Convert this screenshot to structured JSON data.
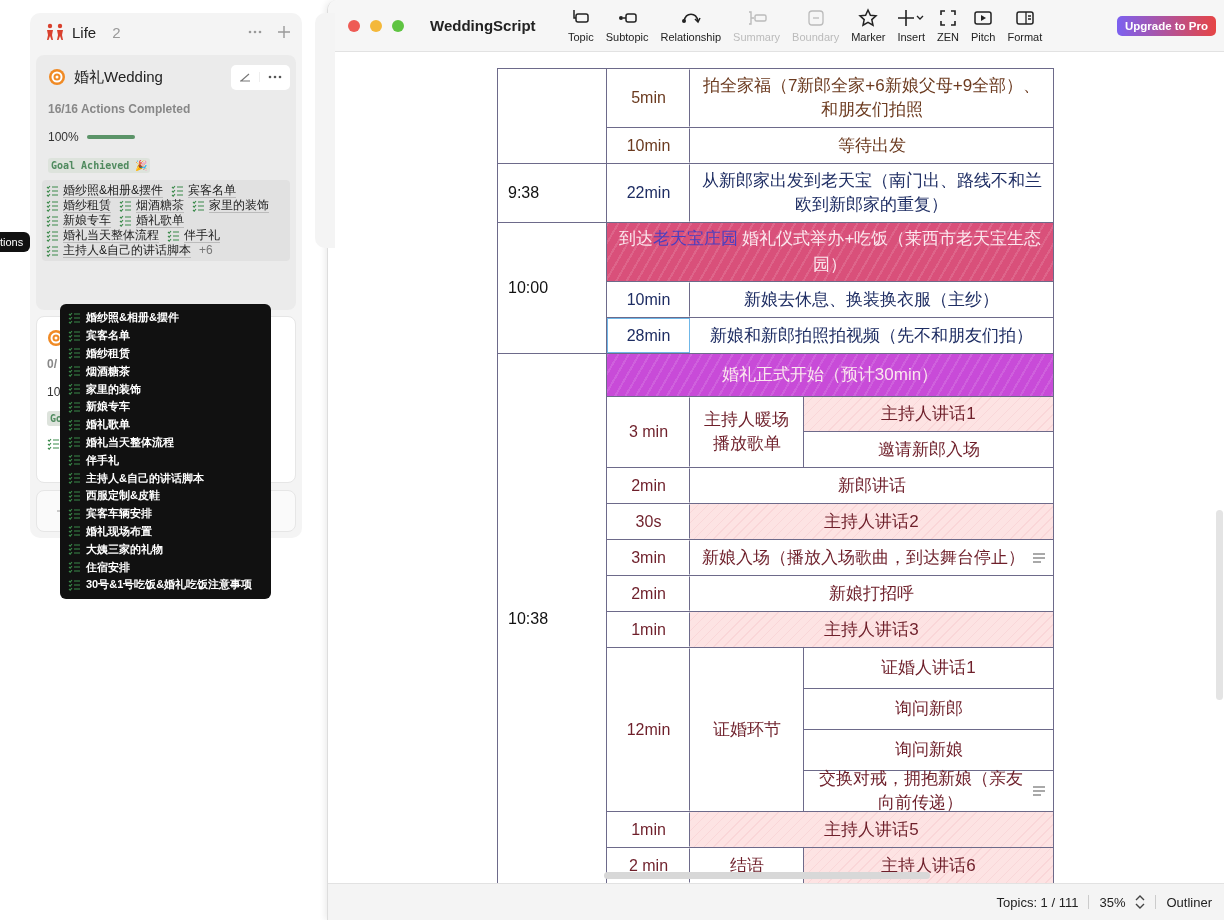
{
  "board": {
    "column": {
      "title": "Life",
      "count": "2"
    },
    "goal_card": {
      "title": "婚礼Wedding",
      "progress_text": "16/16 Actions Completed",
      "percent": "100%",
      "level": 1,
      "badge": "Goal Achieved 🎉",
      "actions": [
        "婚纱照&相册&摆件",
        "宾客名单",
        "婚纱租赁",
        "烟酒糖茶",
        "家里的装饰",
        "新娘专车",
        "婚礼歌单",
        "婚礼当天整体流程",
        "伴手礼",
        "主持人&自己的讲话脚本"
      ],
      "more": "+6"
    },
    "second_card": {
      "progress_text": "0/",
      "percent": "10",
      "badge": "Go"
    },
    "side_tooltip": "tions",
    "popup": [
      "婚纱照&相册&摆件",
      "宾客名单",
      "婚纱租赁",
      "烟酒糖茶",
      "家里的装饰",
      "新娘专车",
      "婚礼歌单",
      "婚礼当天整体流程",
      "伴手礼",
      "主持人&自己的讲话脚本",
      "西服定制&皮鞋",
      "宾客车辆安排",
      "婚礼现场布置",
      "大姨三家的礼物",
      "住宿安排",
      "30号&1号吃饭&婚礼吃饭注意事项"
    ]
  },
  "window": {
    "title": "WeddingScript",
    "toolbar": [
      {
        "label": "Topic",
        "kind": "topic",
        "disabled": false
      },
      {
        "label": "Subtopic",
        "kind": "subtopic",
        "disabled": false
      },
      {
        "label": "Relationship",
        "kind": "relationship",
        "disabled": false
      },
      {
        "label": "Summary",
        "kind": "summary",
        "disabled": true
      },
      {
        "label": "Boundary",
        "kind": "boundary",
        "disabled": true
      },
      {
        "label": "Marker",
        "kind": "marker",
        "disabled": false
      },
      {
        "label": "Insert",
        "kind": "insert",
        "disabled": false
      },
      {
        "label": "ZEN",
        "kind": "zen",
        "disabled": false
      },
      {
        "label": "Pitch",
        "kind": "pitch",
        "disabled": false
      },
      {
        "label": "Format",
        "kind": "format",
        "disabled": false
      }
    ],
    "upgrade": "Upgrade to Pro"
  },
  "schedule": [
    {
      "color": "#6b3a1f",
      "items": [
        {
          "kind": "row",
          "duration": "5min",
          "selected": false,
          "text": "拍全家福（7新郎全家+6新娘父母+9全部）、和朋友们拍照",
          "highlight": false,
          "note": false
        },
        {
          "kind": "row",
          "duration": "10min",
          "selected": false,
          "text": "等待出发",
          "highlight": false,
          "note": false
        }
      ]
    },
    {
      "time": "9:38",
      "color": "#1e2d63",
      "items": [
        {
          "kind": "row",
          "duration": "22min",
          "selected": false,
          "text": "从新郎家出发到老天宝（南门出、路线不和兰欧到新郎家的重复）",
          "highlight": false,
          "note": false
        }
      ]
    },
    {
      "time": "10:00",
      "color": "#1e2d63",
      "items": [
        {
          "kind": "banner",
          "color": "#d9507a",
          "lead": "到达",
          "link": "老天宝庄园",
          "text": " 婚礼仪式举办+吃饭（莱西市老天宝生态园）"
        },
        {
          "kind": "row",
          "duration": "10min",
          "selected": false,
          "text": "新娘去休息、换装换衣服（主纱）",
          "highlight": false,
          "note": false
        },
        {
          "kind": "row",
          "duration": "28min",
          "selected": true,
          "text": "新娘和新郎拍照拍视频（先不和朋友们拍）",
          "highlight": false,
          "note": false
        }
      ]
    },
    {
      "time": "10:38",
      "color": "#6e1f2a",
      "items": [
        {
          "kind": "banner",
          "color": "#c84bd8",
          "text": "婚礼正式开始（预计30min）"
        },
        {
          "kind": "split",
          "duration": "3 min",
          "selected": false,
          "label": "主持人暖场播放歌单",
          "subs": [
            {
              "text": "主持人讲话1",
              "highlight": true,
              "note": false
            },
            {
              "text": "邀请新郎入场",
              "highlight": false,
              "note": false
            }
          ]
        },
        {
          "kind": "row",
          "duration": "2min",
          "selected": false,
          "text": "新郎讲话",
          "highlight": false,
          "note": false
        },
        {
          "kind": "row",
          "duration": "30s",
          "selected": false,
          "text": "主持人讲话2",
          "highlight": true,
          "note": false
        },
        {
          "kind": "row",
          "duration": "3min",
          "selected": false,
          "text": "新娘入场（播放入场歌曲，到达舞台停止）",
          "highlight": false,
          "note": true
        },
        {
          "kind": "row",
          "duration": "2min",
          "selected": false,
          "text": "新娘打招呼",
          "highlight": false,
          "note": false
        },
        {
          "kind": "row",
          "duration": "1min",
          "selected": false,
          "text": "主持人讲话3",
          "highlight": true,
          "note": false
        },
        {
          "kind": "split",
          "duration": "12min",
          "selected": false,
          "label": "证婚环节",
          "subs": [
            {
              "text": "证婚人讲话1",
              "highlight": false,
              "note": false
            },
            {
              "text": "询问新郎",
              "highlight": false,
              "note": false
            },
            {
              "text": "询问新娘",
              "highlight": false,
              "note": false
            },
            {
              "text": "交换对戒，拥抱新娘（亲友向前传递）",
              "highlight": false,
              "note": true
            }
          ]
        },
        {
          "kind": "row",
          "duration": "1min",
          "selected": false,
          "text": "主持人讲话5",
          "highlight": true,
          "note": false
        },
        {
          "kind": "split",
          "duration": "2 min",
          "selected": false,
          "label": "结语",
          "subs": [
            {
              "text": "主持人讲话6",
              "highlight": true,
              "note": false
            }
          ]
        }
      ]
    }
  ],
  "status_bar": {
    "topics": "Topics: 1 / 111",
    "zoom": "35%",
    "view": "Outliner"
  }
}
